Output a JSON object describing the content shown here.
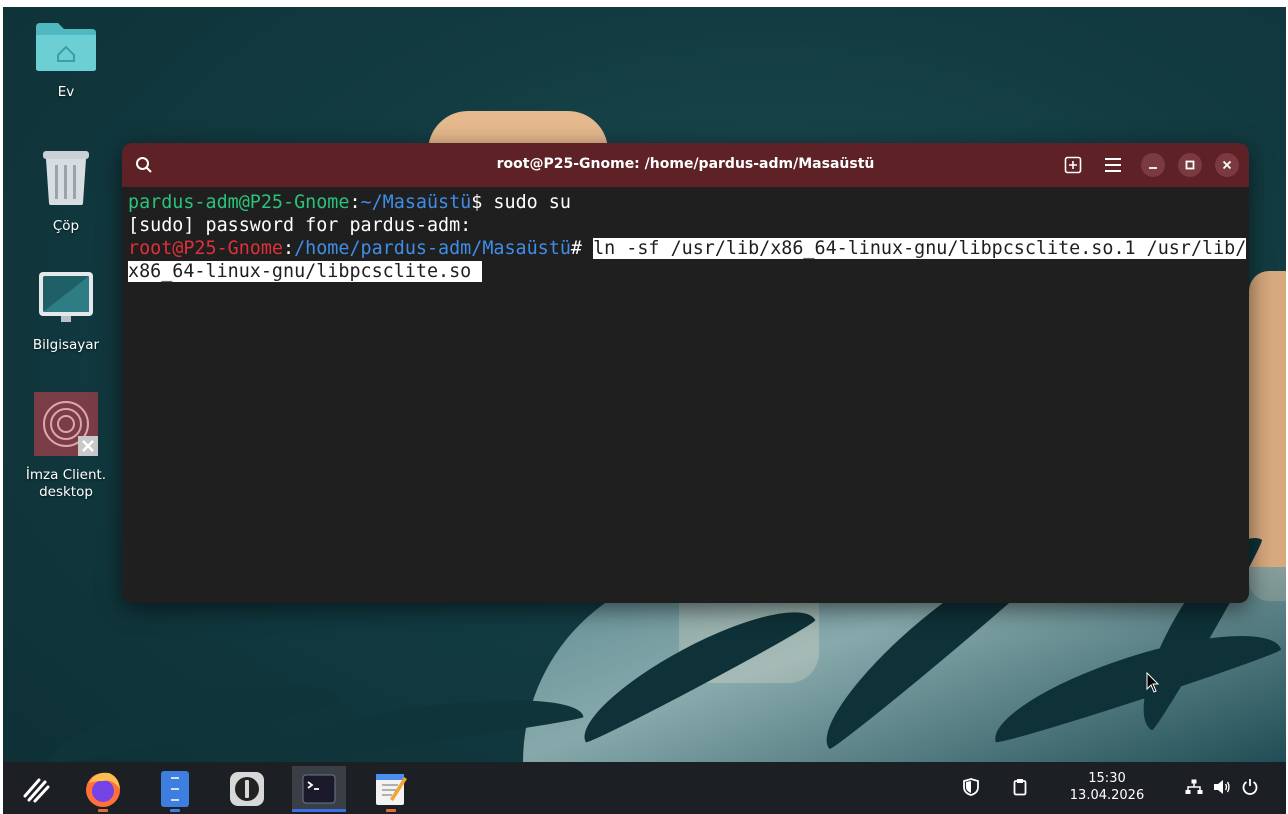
{
  "desktop": {
    "icons": [
      {
        "label": "Ev",
        "icon": "home-folder-icon"
      },
      {
        "label": "Çöp",
        "icon": "trash-icon"
      },
      {
        "label": "Bilgisayar",
        "icon": "computer-icon"
      },
      {
        "label": "İmza Client.\ndesktop",
        "icon": "imza-client-icon"
      }
    ]
  },
  "terminal": {
    "title": "root@P25-Gnome: /home/pardus-adm/Masaüstü",
    "line1": {
      "user": "pardus-adm@P25-Gnome",
      "sep": ":",
      "path": "~/Masaüstü",
      "prompt": "$ ",
      "cmd": "sudo su"
    },
    "line2": "[sudo] password for pardus-adm:",
    "line3": {
      "user": "root@P25-Gnome",
      "sep": ":",
      "path": "/home/pardus-adm/Masaüstü",
      "prompt": "# ",
      "cmd_a": "ln -sf /usr/lib/x86_64-linux-gnu/libpcsclite.so.1 /usr/lib/",
      "cmd_b": "x86_64-linux-gnu/libpcsclite.so "
    }
  },
  "taskbar": {
    "apps": [
      "app-menu-icon",
      "firefox-icon",
      "file-manager-icon",
      "password-manager-icon",
      "terminal-icon",
      "text-editor-icon"
    ],
    "clock": {
      "time": "15:30",
      "date": "13.04.2026"
    }
  },
  "colors": {
    "titlebar": "#5e2126",
    "terminal_bg": "#1f1f1f",
    "user_green": "#2bc27a",
    "path_blue": "#3e8ee8",
    "root_red": "#e0303a"
  }
}
